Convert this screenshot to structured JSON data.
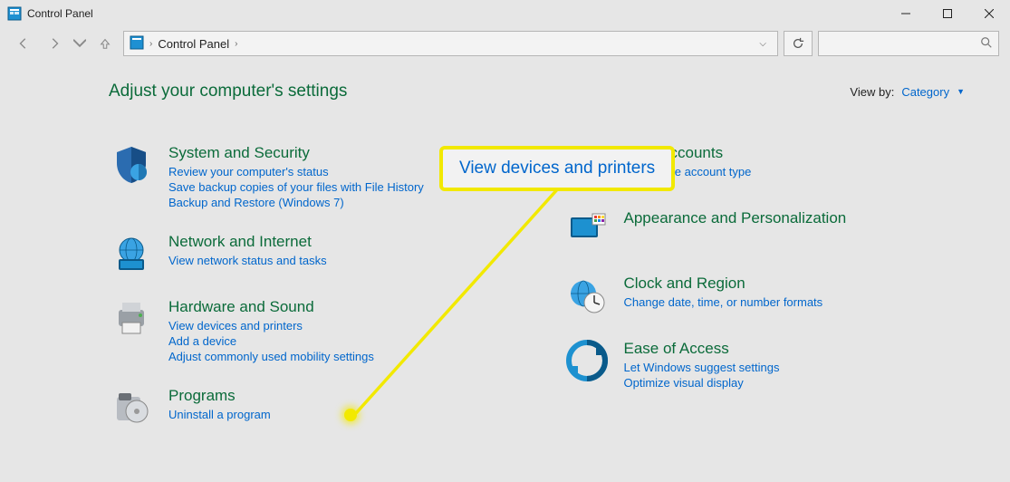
{
  "window": {
    "title": "Control Panel"
  },
  "breadcrumb": {
    "root": "Control Panel"
  },
  "page": {
    "heading": "Adjust your computer's settings"
  },
  "viewby": {
    "label": "View by:",
    "value": "Category"
  },
  "callout": {
    "text": "View devices and printers"
  },
  "categories": {
    "left": [
      {
        "title": "System and Security",
        "links": [
          "Review your computer's status",
          "Save backup copies of your files with File History",
          "Backup and Restore (Windows 7)"
        ]
      },
      {
        "title": "Network and Internet",
        "links": [
          "View network status and tasks"
        ]
      },
      {
        "title": "Hardware and Sound",
        "links": [
          "View devices and printers",
          "Add a device",
          "Adjust commonly used mobility settings"
        ]
      },
      {
        "title": "Programs",
        "links": [
          "Uninstall a program"
        ]
      }
    ],
    "right": [
      {
        "title": "User Accounts",
        "links": [
          "Change account type"
        ],
        "shield": true
      },
      {
        "title": "Appearance and Personalization",
        "links": []
      },
      {
        "title": "Clock and Region",
        "links": [
          "Change date, time, or number formats"
        ]
      },
      {
        "title": "Ease of Access",
        "links": [
          "Let Windows suggest settings",
          "Optimize visual display"
        ]
      }
    ]
  }
}
